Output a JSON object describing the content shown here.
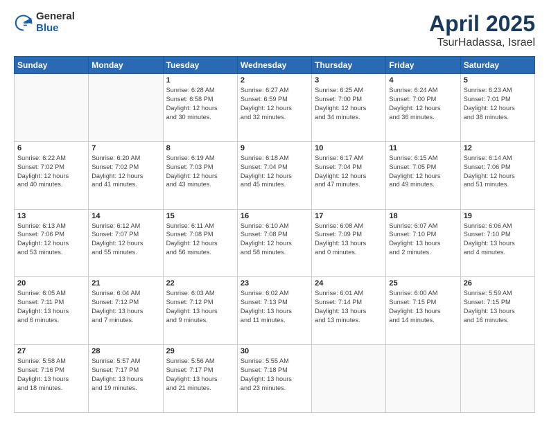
{
  "header": {
    "logo_general": "General",
    "logo_blue": "Blue",
    "month_title": "April 2025",
    "location": "TsurHadassa, Israel"
  },
  "weekdays": [
    "Sunday",
    "Monday",
    "Tuesday",
    "Wednesday",
    "Thursday",
    "Friday",
    "Saturday"
  ],
  "weeks": [
    [
      {
        "day": "",
        "info": ""
      },
      {
        "day": "",
        "info": ""
      },
      {
        "day": "1",
        "info": "Sunrise: 6:28 AM\nSunset: 6:58 PM\nDaylight: 12 hours\nand 30 minutes."
      },
      {
        "day": "2",
        "info": "Sunrise: 6:27 AM\nSunset: 6:59 PM\nDaylight: 12 hours\nand 32 minutes."
      },
      {
        "day": "3",
        "info": "Sunrise: 6:25 AM\nSunset: 7:00 PM\nDaylight: 12 hours\nand 34 minutes."
      },
      {
        "day": "4",
        "info": "Sunrise: 6:24 AM\nSunset: 7:00 PM\nDaylight: 12 hours\nand 36 minutes."
      },
      {
        "day": "5",
        "info": "Sunrise: 6:23 AM\nSunset: 7:01 PM\nDaylight: 12 hours\nand 38 minutes."
      }
    ],
    [
      {
        "day": "6",
        "info": "Sunrise: 6:22 AM\nSunset: 7:02 PM\nDaylight: 12 hours\nand 40 minutes."
      },
      {
        "day": "7",
        "info": "Sunrise: 6:20 AM\nSunset: 7:02 PM\nDaylight: 12 hours\nand 41 minutes."
      },
      {
        "day": "8",
        "info": "Sunrise: 6:19 AM\nSunset: 7:03 PM\nDaylight: 12 hours\nand 43 minutes."
      },
      {
        "day": "9",
        "info": "Sunrise: 6:18 AM\nSunset: 7:04 PM\nDaylight: 12 hours\nand 45 minutes."
      },
      {
        "day": "10",
        "info": "Sunrise: 6:17 AM\nSunset: 7:04 PM\nDaylight: 12 hours\nand 47 minutes."
      },
      {
        "day": "11",
        "info": "Sunrise: 6:15 AM\nSunset: 7:05 PM\nDaylight: 12 hours\nand 49 minutes."
      },
      {
        "day": "12",
        "info": "Sunrise: 6:14 AM\nSunset: 7:06 PM\nDaylight: 12 hours\nand 51 minutes."
      }
    ],
    [
      {
        "day": "13",
        "info": "Sunrise: 6:13 AM\nSunset: 7:06 PM\nDaylight: 12 hours\nand 53 minutes."
      },
      {
        "day": "14",
        "info": "Sunrise: 6:12 AM\nSunset: 7:07 PM\nDaylight: 12 hours\nand 55 minutes."
      },
      {
        "day": "15",
        "info": "Sunrise: 6:11 AM\nSunset: 7:08 PM\nDaylight: 12 hours\nand 56 minutes."
      },
      {
        "day": "16",
        "info": "Sunrise: 6:10 AM\nSunset: 7:08 PM\nDaylight: 12 hours\nand 58 minutes."
      },
      {
        "day": "17",
        "info": "Sunrise: 6:08 AM\nSunset: 7:09 PM\nDaylight: 13 hours\nand 0 minutes."
      },
      {
        "day": "18",
        "info": "Sunrise: 6:07 AM\nSunset: 7:10 PM\nDaylight: 13 hours\nand 2 minutes."
      },
      {
        "day": "19",
        "info": "Sunrise: 6:06 AM\nSunset: 7:10 PM\nDaylight: 13 hours\nand 4 minutes."
      }
    ],
    [
      {
        "day": "20",
        "info": "Sunrise: 6:05 AM\nSunset: 7:11 PM\nDaylight: 13 hours\nand 6 minutes."
      },
      {
        "day": "21",
        "info": "Sunrise: 6:04 AM\nSunset: 7:12 PM\nDaylight: 13 hours\nand 7 minutes."
      },
      {
        "day": "22",
        "info": "Sunrise: 6:03 AM\nSunset: 7:12 PM\nDaylight: 13 hours\nand 9 minutes."
      },
      {
        "day": "23",
        "info": "Sunrise: 6:02 AM\nSunset: 7:13 PM\nDaylight: 13 hours\nand 11 minutes."
      },
      {
        "day": "24",
        "info": "Sunrise: 6:01 AM\nSunset: 7:14 PM\nDaylight: 13 hours\nand 13 minutes."
      },
      {
        "day": "25",
        "info": "Sunrise: 6:00 AM\nSunset: 7:15 PM\nDaylight: 13 hours\nand 14 minutes."
      },
      {
        "day": "26",
        "info": "Sunrise: 5:59 AM\nSunset: 7:15 PM\nDaylight: 13 hours\nand 16 minutes."
      }
    ],
    [
      {
        "day": "27",
        "info": "Sunrise: 5:58 AM\nSunset: 7:16 PM\nDaylight: 13 hours\nand 18 minutes."
      },
      {
        "day": "28",
        "info": "Sunrise: 5:57 AM\nSunset: 7:17 PM\nDaylight: 13 hours\nand 19 minutes."
      },
      {
        "day": "29",
        "info": "Sunrise: 5:56 AM\nSunset: 7:17 PM\nDaylight: 13 hours\nand 21 minutes."
      },
      {
        "day": "30",
        "info": "Sunrise: 5:55 AM\nSunset: 7:18 PM\nDaylight: 13 hours\nand 23 minutes."
      },
      {
        "day": "",
        "info": ""
      },
      {
        "day": "",
        "info": ""
      },
      {
        "day": "",
        "info": ""
      }
    ]
  ]
}
